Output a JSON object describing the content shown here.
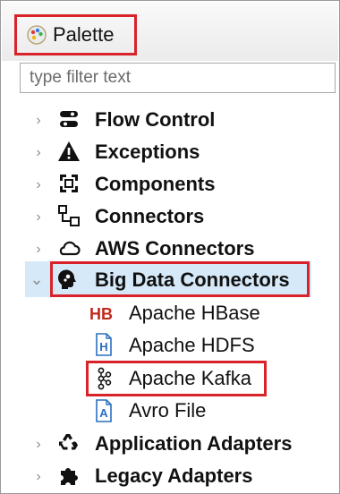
{
  "palette": {
    "title": "Palette",
    "icon": "palette-icon",
    "filter_placeholder": "type filter text"
  },
  "tree": {
    "categories": [
      {
        "label": "Flow Control",
        "icon": "flow-control-icon",
        "expanded": false
      },
      {
        "label": "Exceptions",
        "icon": "warning-icon",
        "expanded": false
      },
      {
        "label": "Components",
        "icon": "components-icon",
        "expanded": false
      },
      {
        "label": "Connectors",
        "icon": "connectors-icon",
        "expanded": false
      },
      {
        "label": "AWS Connectors",
        "icon": "cloud-icon",
        "expanded": false
      },
      {
        "label": "Big Data Connectors",
        "icon": "big-data-icon",
        "expanded": true,
        "selected": true
      },
      {
        "label": "Application Adapters",
        "icon": "recycle-icon",
        "expanded": false
      },
      {
        "label": "Legacy Adapters",
        "icon": "puzzle-icon",
        "expanded": false
      }
    ],
    "children": [
      {
        "label": "Apache HBase",
        "icon": "hbase-icon",
        "icon_text": "HB"
      },
      {
        "label": "Apache HDFS",
        "icon": "hdfs-icon",
        "icon_text": "H"
      },
      {
        "label": "Apache Kafka",
        "icon": "kafka-icon"
      },
      {
        "label": "Avro File",
        "icon": "avro-icon",
        "icon_text": "A"
      }
    ]
  },
  "colors": {
    "highlight": "#d8232a",
    "selection": "#d6e9f8"
  }
}
